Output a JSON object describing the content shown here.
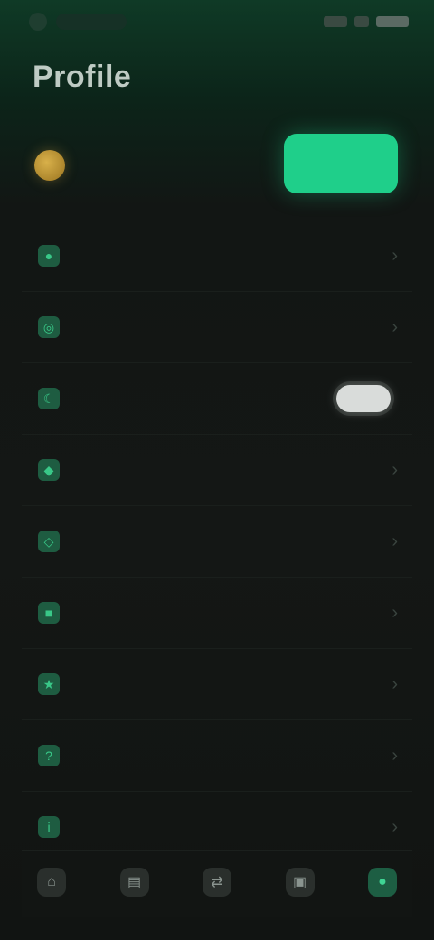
{
  "app": {
    "title": "Profile"
  },
  "status": {
    "time": ""
  },
  "account": {
    "coin_icon": "coin-icon",
    "balance_label": "",
    "primary_button_label": ""
  },
  "settings": [
    {
      "icon": "user-icon",
      "glyph": "●",
      "label": "",
      "value": "",
      "control": "chevron"
    },
    {
      "icon": "globe-icon",
      "glyph": "◎",
      "label": "",
      "value": "",
      "control": "chevron"
    },
    {
      "icon": "moon-icon",
      "glyph": "☾",
      "label": "",
      "value": "",
      "control": "toggle"
    },
    {
      "icon": "bell-icon",
      "glyph": "◆",
      "label": "",
      "value": "",
      "control": "chevron"
    },
    {
      "icon": "shield-icon",
      "glyph": "◇",
      "label": "",
      "value": "",
      "control": "chevron"
    },
    {
      "icon": "lock-icon",
      "glyph": "■",
      "label": "",
      "value": "",
      "control": "chevron"
    },
    {
      "icon": "star-icon",
      "glyph": "★",
      "label": "",
      "value": "",
      "control": "chevron"
    },
    {
      "icon": "help-icon",
      "glyph": "?",
      "label": "",
      "value": "",
      "control": "chevron"
    },
    {
      "icon": "info-icon",
      "glyph": "i",
      "label": "",
      "value": "",
      "control": "chevron"
    }
  ],
  "tabs": [
    {
      "icon": "home-icon",
      "glyph": "⌂",
      "label": ""
    },
    {
      "icon": "chart-icon",
      "glyph": "▤",
      "label": ""
    },
    {
      "icon": "swap-icon",
      "glyph": "⇄",
      "label": ""
    },
    {
      "icon": "wallet-icon",
      "glyph": "▣",
      "label": ""
    },
    {
      "icon": "profile-icon",
      "glyph": "●",
      "label": "",
      "active": true
    }
  ],
  "colors": {
    "accent": "#1fcf8a",
    "background": "#141715",
    "header_tint": "#0f3a26",
    "coin": "#d8b04a"
  }
}
